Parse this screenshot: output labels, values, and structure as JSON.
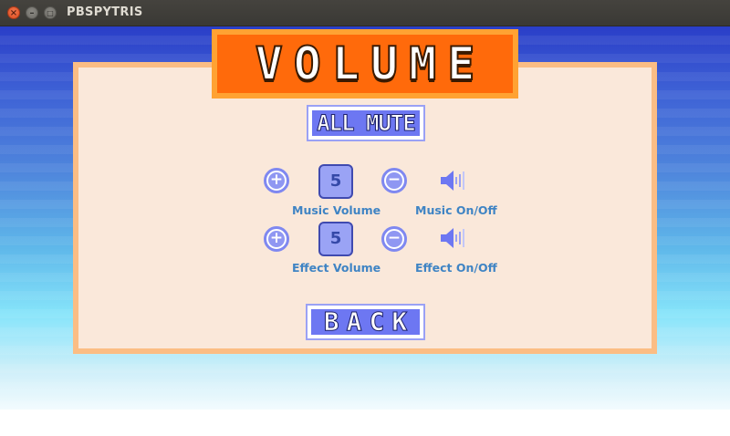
{
  "window": {
    "title": "PBSPYTRIS",
    "close_glyph": "×",
    "minimize_glyph": "–",
    "maximize_glyph": "□"
  },
  "screen": {
    "heading": "VOLUME",
    "all_mute_label": "ALL MUTE",
    "back_label": "BACK"
  },
  "music": {
    "volume_value": "5",
    "volume_label": "Music Volume",
    "toggle_label": "Music On/Off",
    "increase_glyph": "+",
    "decrease_glyph": "−"
  },
  "effect": {
    "volume_value": "5",
    "volume_label": "Effect Volume",
    "toggle_label": "Effect On/Off",
    "increase_glyph": "+",
    "decrease_glyph": "−"
  },
  "icons": {
    "increase": "plus-circle-icon",
    "decrease": "minus-circle-icon",
    "sound": "speaker-icon"
  },
  "colors": {
    "banner_fill": "#ff6a0b",
    "banner_border": "#ffa233",
    "panel_fill": "#fae8da",
    "panel_border": "#fbbd84",
    "button_fill": "#6d77f2",
    "label_text": "#3f84c4"
  }
}
